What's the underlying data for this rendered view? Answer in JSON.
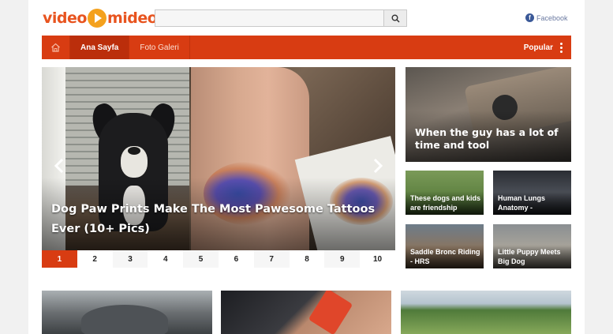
{
  "header": {
    "logo_part1": "video",
    "logo_part2": "mideo",
    "search_placeholder": "",
    "facebook_label": "Facebook"
  },
  "nav": {
    "items": [
      {
        "label": "Ana Sayfa",
        "active": true
      },
      {
        "label": "Foto Galeri",
        "active": false
      }
    ],
    "popular_label": "Popular"
  },
  "slider": {
    "caption": "Dog Paw Prints Make The Most Pawesome Tattoos Ever (10+ Pics)",
    "pages": [
      "1",
      "2",
      "3",
      "4",
      "5",
      "6",
      "7",
      "8",
      "9",
      "10"
    ],
    "active_page": "1"
  },
  "featured": {
    "caption": "When the guy has a lot of time and tool"
  },
  "thumbs": [
    {
      "caption": "These dogs and kids are friendship"
    },
    {
      "caption": "Human Lungs Anatomy -"
    },
    {
      "caption": "Saddle Bronc Riding - HRS"
    },
    {
      "caption": "Little Puppy Meets Big Dog"
    }
  ],
  "colors": {
    "brand": "#d83c12",
    "logo_orange": "#e8541f",
    "logo_play": "#f4a11d"
  },
  "icons": {
    "home": "home-icon",
    "search": "search-icon",
    "facebook": "facebook-icon",
    "menu": "vertical-dots-icon",
    "prev": "chevron-left-icon",
    "next": "chevron-right-icon"
  }
}
